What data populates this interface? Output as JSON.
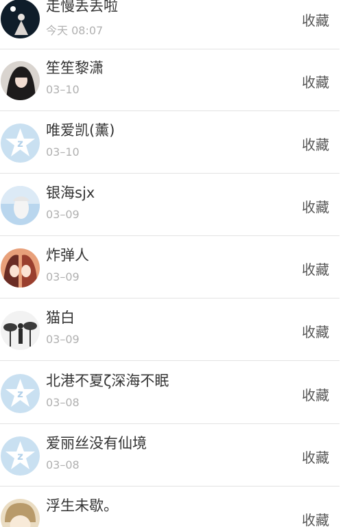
{
  "list": {
    "items": [
      {
        "name": "走慢丢丢啦",
        "time": "今天 08:07",
        "action": "收藏",
        "avatar": "user-photo-avatar"
      },
      {
        "name": "笙笙黎潇",
        "time": "03–10",
        "action": "收藏",
        "avatar": "user-photo-avatar"
      },
      {
        "name": "唯爱凯(薰)",
        "time": "03–10",
        "action": "收藏",
        "avatar": "default-qq-avatar"
      },
      {
        "name": "银海sjx",
        "time": "03–09",
        "action": "收藏",
        "avatar": "user-photo-avatar"
      },
      {
        "name": "炸弹人",
        "time": "03–09",
        "action": "收藏",
        "avatar": "user-photo-avatar"
      },
      {
        "name": "猫白",
        "time": "03–09",
        "action": "收藏",
        "avatar": "user-photo-avatar"
      },
      {
        "name": "北港不夏ζ深海不眠",
        "time": "03–08",
        "action": "收藏",
        "avatar": "default-qq-avatar"
      },
      {
        "name": "爱丽丝没有仙境",
        "time": "03–08",
        "action": "收藏",
        "avatar": "default-qq-avatar"
      },
      {
        "name": "浮生未歇。",
        "time": "",
        "action": "收藏",
        "avatar": "user-photo-avatar"
      }
    ]
  }
}
